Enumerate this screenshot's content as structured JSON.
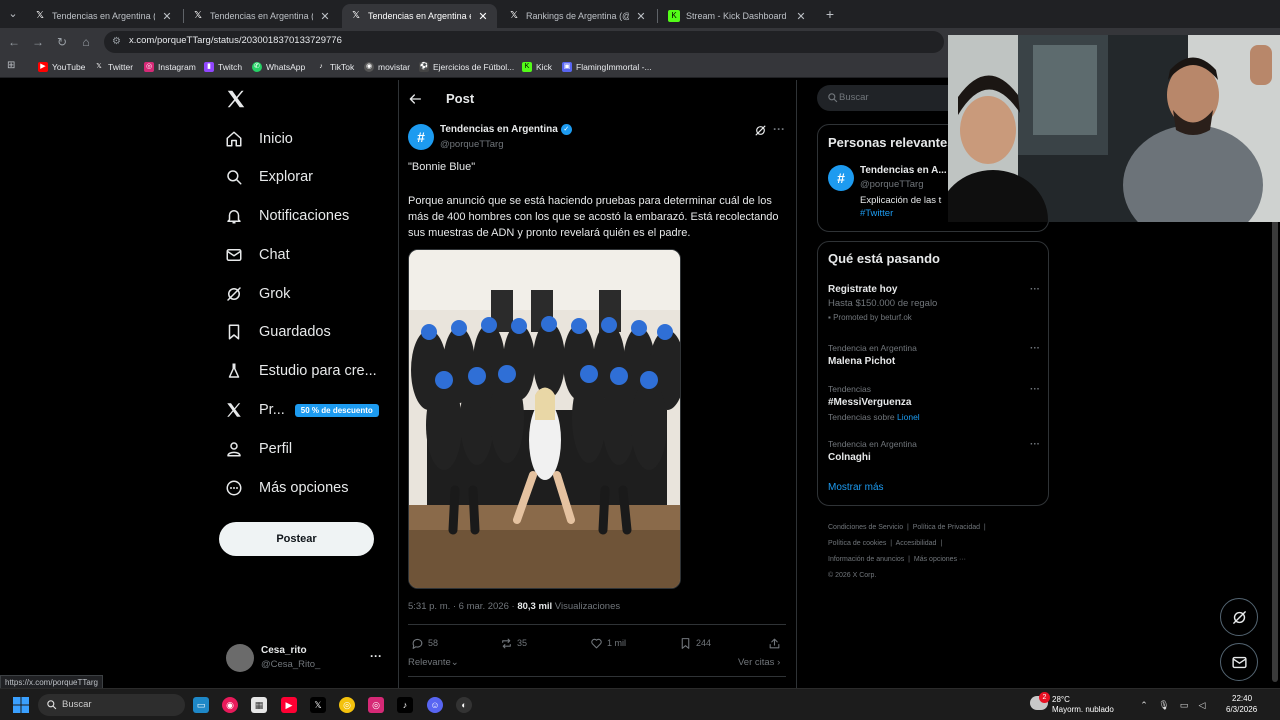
{
  "browser": {
    "tabs": [
      {
        "title": "Tendencias en Argentina (@porq",
        "active": false
      },
      {
        "title": "Tendencias en Argentina (@porq",
        "active": false
      },
      {
        "title": "Tendencias en Argentina en X: \"",
        "active": true
      },
      {
        "title": "Rankings de Argentina (@Argen",
        "active": false
      },
      {
        "title": "Stream - Kick Dashboard",
        "active": false
      }
    ],
    "url": "x.com/porqueTTarg/status/2030018370133729776",
    "bookmarks": [
      "YouTube",
      "Twitter",
      "Instagram",
      "Twitch",
      "WhatsApp",
      "TikTok",
      "movistar",
      "Ejercicios de Fútbol...",
      "Kick",
      "FlamingImmortal -..."
    ]
  },
  "nav": {
    "items": [
      "Inicio",
      "Explorar",
      "Notificaciones",
      "Chat",
      "Grok",
      "Guardados",
      "Estudio para cre...",
      "Pr...",
      "Perfil",
      "Más opciones"
    ],
    "premium_badge": "50 % de descuento",
    "post_button": "Postear",
    "account": {
      "name": "Cesa_rito",
      "handle": "@Cesa_Rito_"
    }
  },
  "post": {
    "header": "Post",
    "author": {
      "name": "Tendencias en Argentina",
      "handle": "@porqueTTarg"
    },
    "quote": "\"Bonnie Blue\"",
    "text": "Porque anunció que se está haciendo pruebas para determinar cuál de los más de 400 hombres con los que se acostó la embarazó. Está recolectando sus muestras de ADN y pronto revelará quién es el padre.",
    "timestamp": "5:31 p. m. · 6 mar. 2026 · ",
    "views": "80,3 mil",
    "views_label": " Visualizaciones",
    "stats": {
      "replies": "58",
      "reposts": "35",
      "likes": "1 mil",
      "bookmarks": "244"
    },
    "sort_label": "Relevante",
    "quotes_label": "Ver citas"
  },
  "sidebar": {
    "search_placeholder": "Buscar",
    "relevant_title": "Personas relevantes",
    "relevant": {
      "name": "Tendencias en A...",
      "handle": "@porqueTTarg",
      "bio": "Explicación de las t",
      "tag": "#Twitter"
    },
    "trends_title": "Qué está pasando",
    "trends": [
      {
        "context": "",
        "name": "Registrate hoy",
        "sub": "Hasta $150.000 de regalo",
        "promo": "Promoted by beturf.ok"
      },
      {
        "context": "Tendencia en Argentina",
        "name": "Malena Pichot",
        "sub": "",
        "promo": ""
      },
      {
        "context": "Tendencias",
        "name": "#MessiVerguenza",
        "sub": "Tendencias sobre ",
        "link": "Lionel"
      },
      {
        "context": "Tendencia en Argentina",
        "name": "Colnaghi",
        "sub": "",
        "promo": ""
      }
    ],
    "show_more": "Mostrar más",
    "footer": [
      "Condiciones de Servicio",
      "Política de Privacidad",
      "Política de cookies",
      "Accesibilidad",
      "Información de anuncios",
      "Más opciones ···",
      "© 2026 X Corp."
    ]
  },
  "status_url": "https://x.com/porqueTTarg",
  "taskbar": {
    "search": "Buscar",
    "weather_temp": "28°C",
    "weather_desc": "Mayorm. nublado",
    "weather_badge": "2",
    "time": "22:40",
    "date": "6/3/2026"
  },
  "colors": {
    "accent": "#1d9bf0",
    "background": "#000000",
    "border": "#2f3336",
    "muted": "#71767b"
  }
}
